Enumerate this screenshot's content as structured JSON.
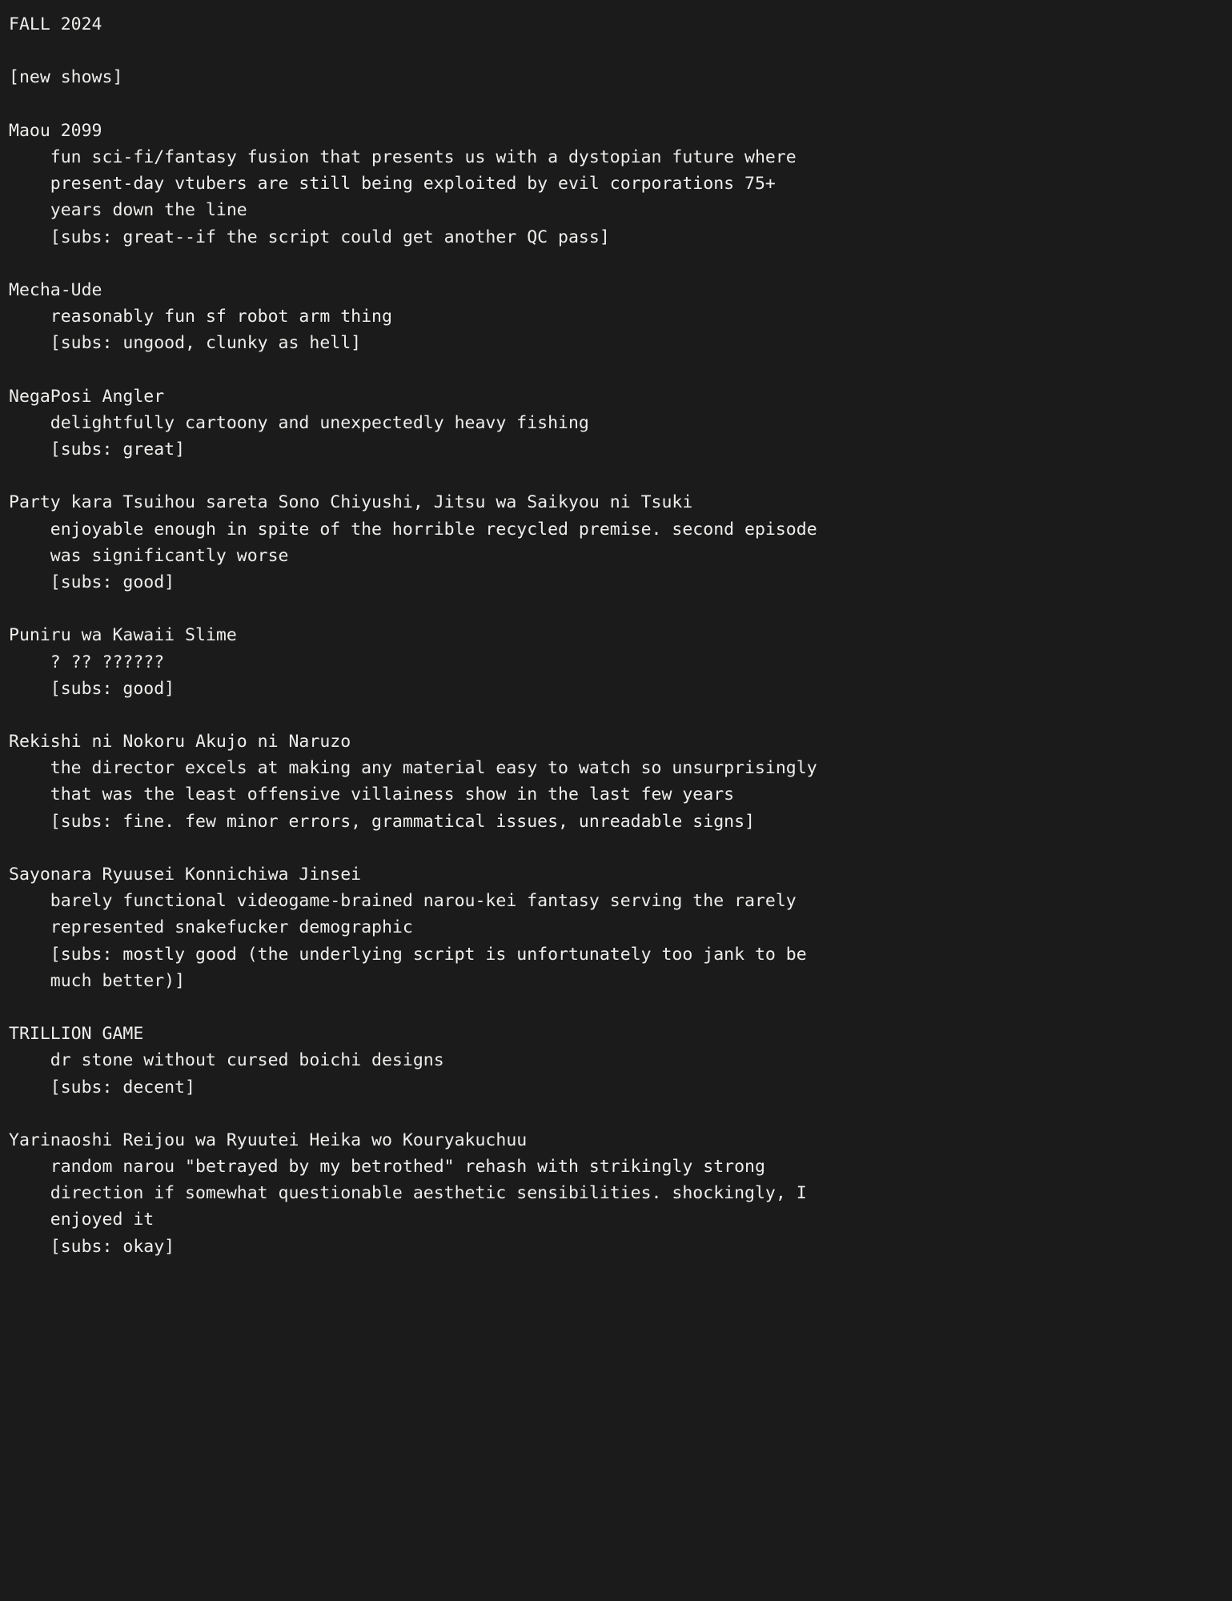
{
  "document": {
    "season_heading": "FALL 2024",
    "section_heading": "[new shows]",
    "indent": "    ",
    "colors": {
      "background": "#1b1b1b",
      "text": "#eeeeec"
    }
  },
  "shows": [
    {
      "title": "Maou 2099",
      "description_lines": [
        "fun sci-fi/fantasy fusion that presents us with a dystopian future where",
        "present-day vtubers are still being exploited by evil corporations 75+",
        "years down the line"
      ],
      "subs_lines": [
        "[subs: great--if the script could get another QC pass]"
      ]
    },
    {
      "title": "Mecha-Ude",
      "description_lines": [
        "reasonably fun sf robot arm thing"
      ],
      "subs_lines": [
        "[subs: ungood, clunky as hell]"
      ]
    },
    {
      "title": "NegaPosi Angler",
      "description_lines": [
        "delightfully cartoony and unexpectedly heavy fishing"
      ],
      "subs_lines": [
        "[subs: great]"
      ]
    },
    {
      "title": "Party kara Tsuihou sareta Sono Chiyushi, Jitsu wa Saikyou ni Tsuki",
      "description_lines": [
        "enjoyable enough in spite of the horrible recycled premise. second episode",
        "was significantly worse"
      ],
      "subs_lines": [
        "[subs: good]"
      ]
    },
    {
      "title": "Puniru wa Kawaii Slime",
      "description_lines": [
        "? ?? ??????"
      ],
      "subs_lines": [
        "[subs: good]"
      ]
    },
    {
      "title": "Rekishi ni Nokoru Akujo ni Naruzo",
      "description_lines": [
        "the director excels at making any material easy to watch so unsurprisingly",
        "that was the least offensive villainess show in the last few years"
      ],
      "subs_lines": [
        "[subs: fine. few minor errors, grammatical issues, unreadable signs]"
      ]
    },
    {
      "title": "Sayonara Ryuusei Konnichiwa Jinsei",
      "description_lines": [
        "barely functional videogame-brained narou-kei fantasy serving the rarely",
        "represented snakefucker demographic"
      ],
      "subs_lines": [
        "[subs: mostly good (the underlying script is unfortunately too jank to be",
        "much better)]"
      ]
    },
    {
      "title": "TRILLION GAME",
      "description_lines": [
        "dr stone without cursed boichi designs"
      ],
      "subs_lines": [
        "[subs: decent]"
      ]
    },
    {
      "title": "Yarinaoshi Reijou wa Ryuutei Heika wo Kouryakuchuu",
      "description_lines": [
        "random narou \"betrayed by my betrothed\" rehash with strikingly strong",
        "direction if somewhat questionable aesthetic sensibilities. shockingly, I",
        "enjoyed it"
      ],
      "subs_lines": [
        "[subs: okay]"
      ]
    }
  ]
}
